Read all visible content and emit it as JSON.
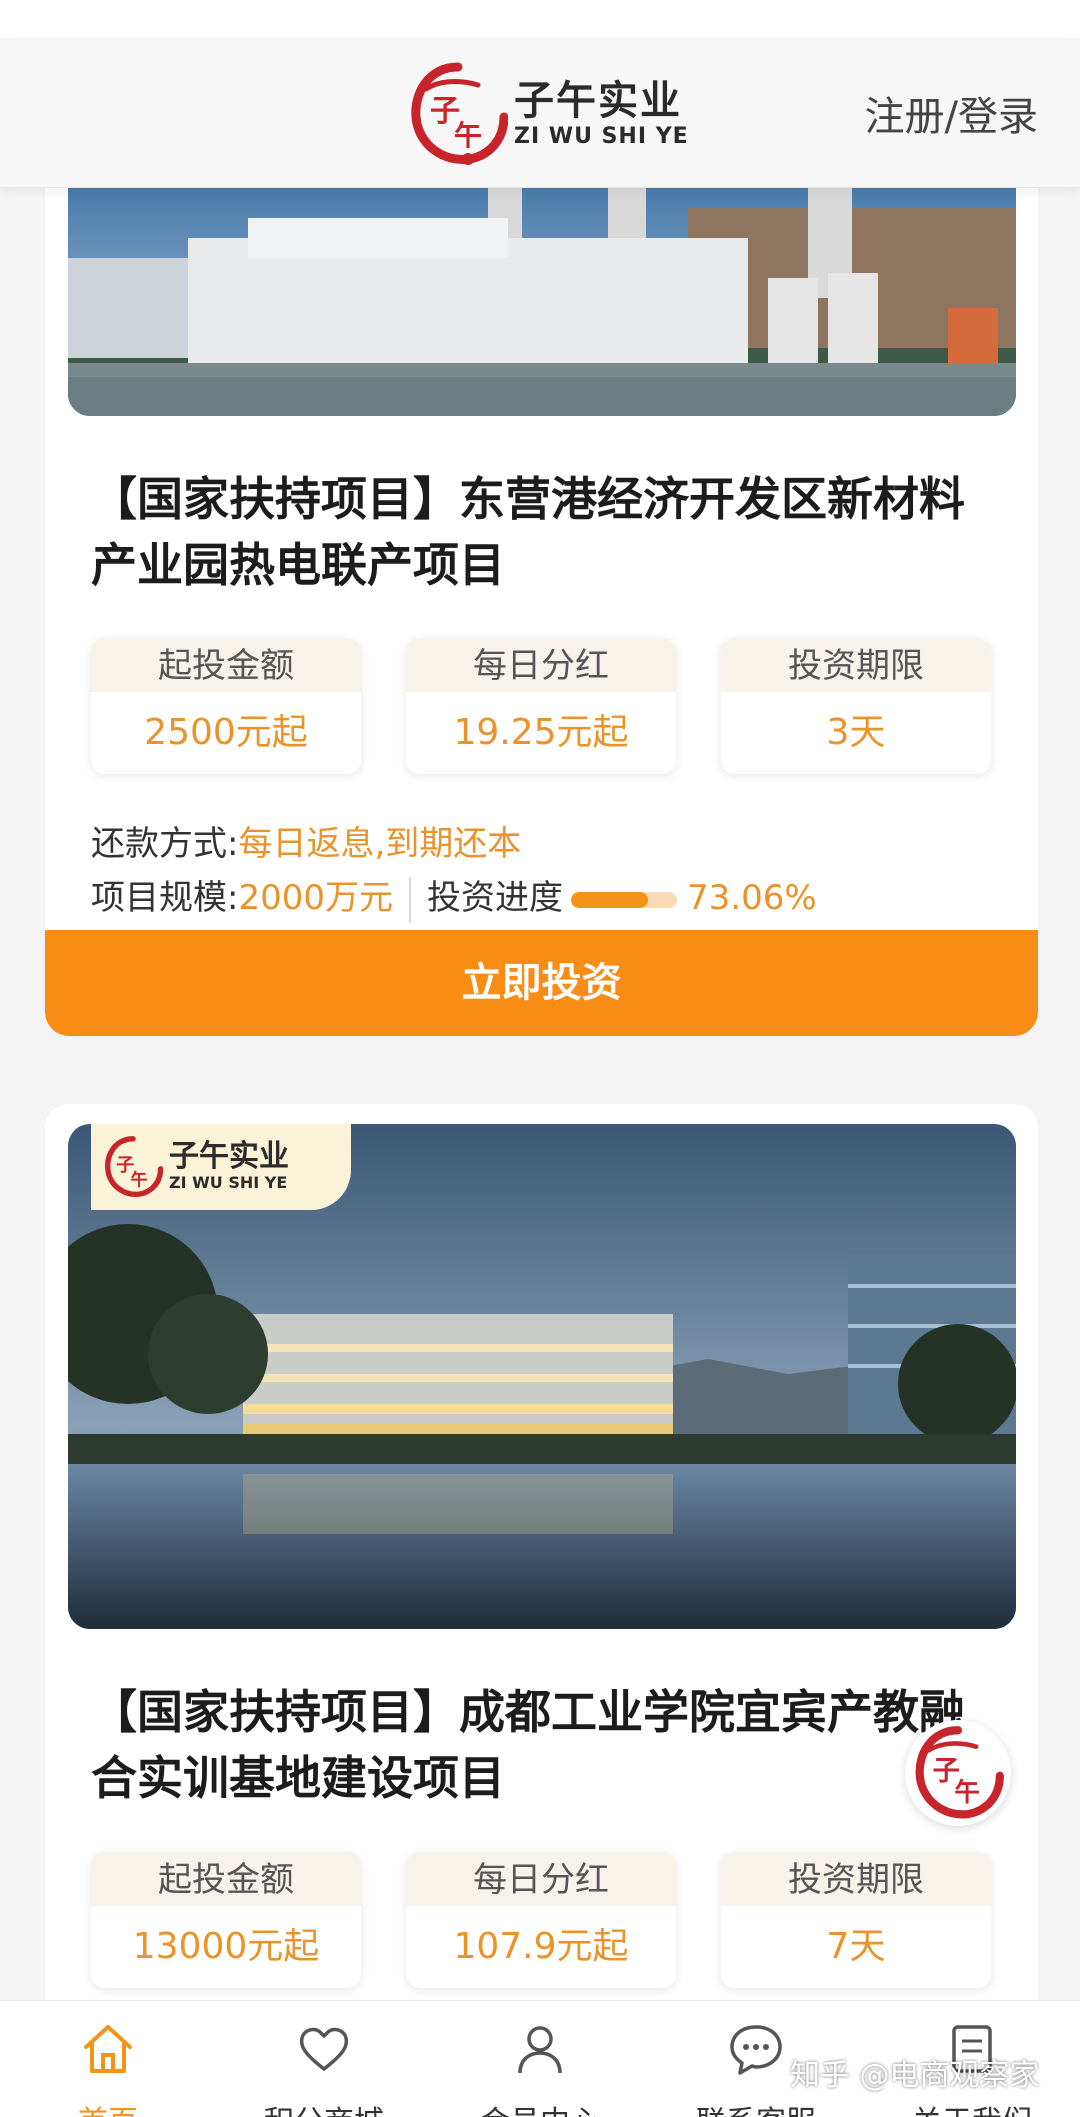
{
  "header": {
    "brand_cn": "子午实业",
    "brand_en": "ZI WU SHI YE",
    "seal_text": "子午",
    "login_label": "注册/登录"
  },
  "projects": [
    {
      "title": "【国家扶持项目】东营港经济开发区新材料产业园热电联产项目",
      "stats": [
        {
          "label": "起投金额",
          "value": "2500元起"
        },
        {
          "label": "每日分红",
          "value": "19.25元起"
        },
        {
          "label": "投资期限",
          "value": "3天"
        }
      ],
      "repayment_label": "还款方式:",
      "repayment_value": "每日返息,到期还本",
      "scale_label": "项目规模:",
      "scale_value": "2000万元",
      "progress_label": "投资进度",
      "progress_text": "73.06%",
      "progress_fraction": 0.7306,
      "button_label": "立即投资"
    },
    {
      "title": "【国家扶持项目】成都工业学院宜宾产教融合实训基地建设项目",
      "stats": [
        {
          "label": "起投金额",
          "value": "13000元起"
        },
        {
          "label": "每日分红",
          "value": "107.9元起"
        },
        {
          "label": "投资期限",
          "value": "7天"
        }
      ]
    }
  ],
  "tabbar": {
    "items": [
      {
        "label": "首页",
        "icon": "home-icon",
        "active": true
      },
      {
        "label": "积分商城",
        "icon": "heart-icon",
        "active": false
      },
      {
        "label": "会员中心",
        "icon": "user-icon",
        "active": false
      },
      {
        "label": "联系客服",
        "icon": "chat-icon",
        "active": false
      },
      {
        "label": "关于我们",
        "icon": "document-icon",
        "active": false
      }
    ]
  },
  "watermark": "知乎 @电商观察家",
  "colors": {
    "accent": "#f88c14",
    "accent_text": "#e9932a",
    "progress_track": "#fbd9b4",
    "logo_red": "#c8242b"
  }
}
